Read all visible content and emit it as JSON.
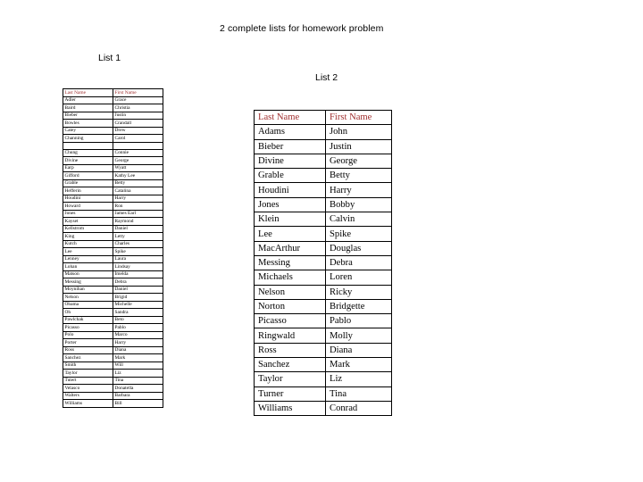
{
  "document": {
    "title": "2 complete lists for homework problem",
    "list1_title": "List 1",
    "list2_title": "List 2",
    "header_color": "#a03030",
    "border_color": "#000000",
    "background_color": "#ffffff"
  },
  "list1": {
    "columns": [
      "Last Name",
      "First Name"
    ],
    "rows": [
      [
        "Adler",
        "Grace"
      ],
      [
        "Baird",
        "Christia"
      ],
      [
        "Bieber",
        "Justin"
      ],
      [
        "Bowles",
        "Crandall"
      ],
      [
        "Catey",
        "Drew"
      ],
      [
        "Channing",
        "Carol"
      ],
      [
        "",
        ""
      ],
      [
        "Chung",
        "Connie"
      ],
      [
        "Divine",
        "George"
      ],
      [
        "Earp",
        "Wyatt"
      ],
      [
        "Gifford",
        "Kathy Lee"
      ],
      [
        "Grable",
        "Betty"
      ],
      [
        "Hefferin",
        "Catalina"
      ],
      [
        "Houdini",
        "Harry"
      ],
      [
        "Howard",
        "Ron"
      ],
      [
        "Jones",
        "James Earl"
      ],
      [
        "Kayset",
        "Raymond"
      ],
      [
        "Kellstrom",
        "Daniel"
      ],
      [
        "King",
        "Letty"
      ],
      [
        "Kutch",
        "Charles"
      ],
      [
        "Lee",
        "Spike"
      ],
      [
        "Lenney",
        "Laura"
      ],
      [
        "Lohan",
        "Lindsay"
      ],
      [
        "Matson",
        "Imelda"
      ],
      [
        "Messing",
        "Debra"
      ],
      [
        "Moynihan",
        "Daniel"
      ],
      [
        "Nelson",
        "Brigid"
      ],
      [
        "Obama",
        "Michelle"
      ],
      [
        "Oh",
        "Sandra"
      ],
      [
        "Pawlchak",
        "Beto"
      ],
      [
        "Picasso",
        "Pablo"
      ],
      [
        "Polo",
        "Marco"
      ],
      [
        "Porter",
        "Harry"
      ],
      [
        "Ross",
        "Diana"
      ],
      [
        "Sanchez",
        "Mark"
      ],
      [
        "Smith",
        "Will"
      ],
      [
        "Taylor",
        "Liz"
      ],
      [
        "Tutert",
        "Tina"
      ],
      [
        "Velasco",
        "Donatella"
      ],
      [
        "Walters",
        "Barbara"
      ],
      [
        "Williams",
        "Bill"
      ]
    ]
  },
  "list2": {
    "columns": [
      "Last Name",
      "First Name"
    ],
    "rows": [
      [
        "Adams",
        "John"
      ],
      [
        "Bieber",
        "Justin"
      ],
      [
        "Divine",
        "George"
      ],
      [
        "Grable",
        "Betty"
      ],
      [
        "Houdini",
        "Harry"
      ],
      [
        "Jones",
        "Bobby"
      ],
      [
        "Klein",
        "Calvin"
      ],
      [
        "Lee",
        "Spike"
      ],
      [
        "MacArthur",
        "Douglas"
      ],
      [
        "Messing",
        "Debra"
      ],
      [
        "Michaels",
        "Loren"
      ],
      [
        "Nelson",
        "Ricky"
      ],
      [
        "Norton",
        "Bridgette"
      ],
      [
        "Picasso",
        "Pablo"
      ],
      [
        "Ringwald",
        "Molly"
      ],
      [
        "Ross",
        "Diana"
      ],
      [
        "Sanchez",
        "Mark"
      ],
      [
        "Taylor",
        "Liz"
      ],
      [
        "Turner",
        "Tina"
      ],
      [
        "Williams",
        "Conrad"
      ]
    ]
  }
}
